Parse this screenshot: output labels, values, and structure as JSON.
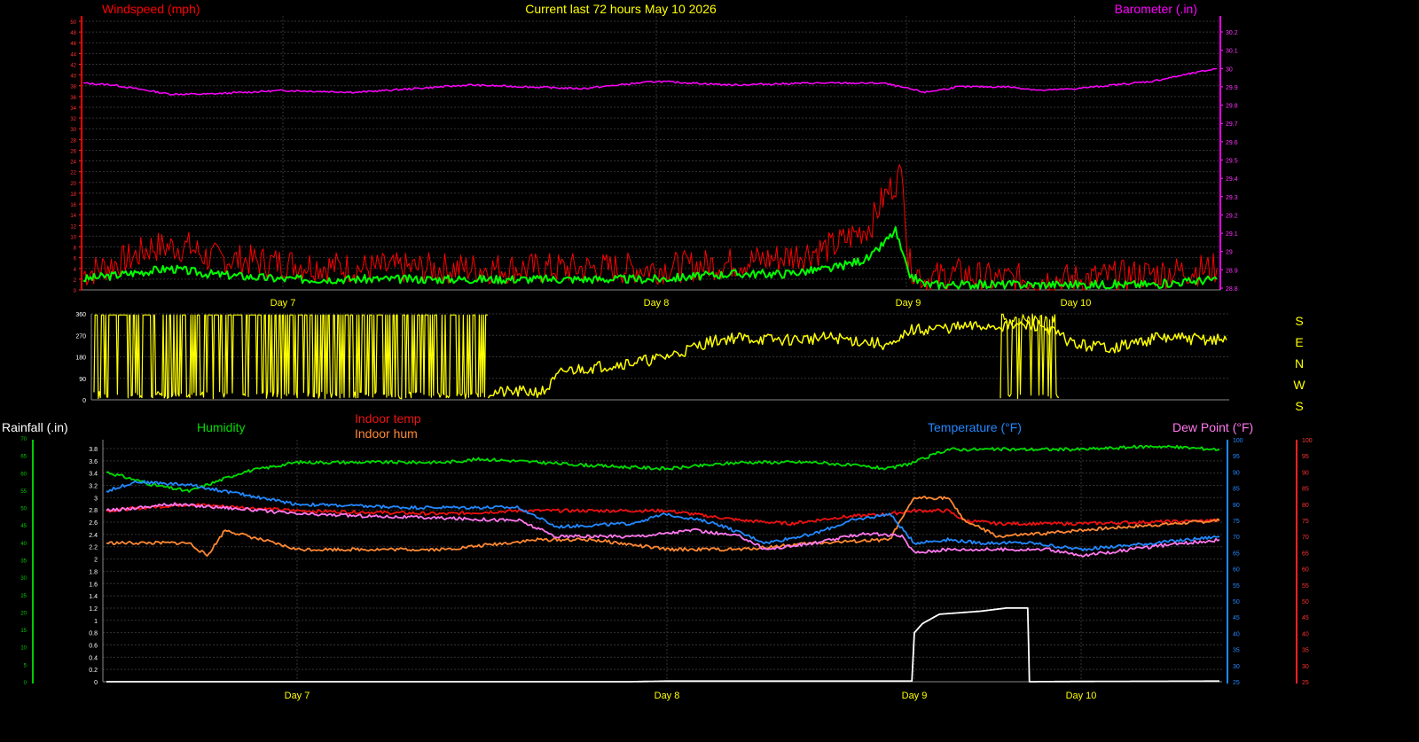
{
  "title": "Current last 72 hours May 10 2026",
  "colors": {
    "bg": "#000000",
    "grid": "#333333",
    "axis": "#888888",
    "tick": "#ffff00",
    "wind_gust": "#ff0000",
    "wind_avg": "#00ff00",
    "barometer": "#ff00ff",
    "direction": "#ffff00",
    "humidity": "#00dd00",
    "indoor_temp": "#ee1111",
    "indoor_hum": "#ff8833",
    "temperature": "#2288ff",
    "dewpoint": "#ff77ee",
    "rainfall": "#ffffff",
    "rain_axis": "#00cc00"
  },
  "day_labels": [
    "Day 7",
    "Day 8",
    "Day 9",
    "Day 10"
  ],
  "compass": [
    "S",
    "E",
    "N",
    "W",
    "S"
  ],
  "chart_data": [
    {
      "id": "wind-baro",
      "type": "line",
      "left_axis_label": "Windspeed (mph)",
      "right_axis_label": "Barometer (.in)",
      "x": [
        "May 7 00:00",
        "May 8 00:00",
        "May 9 00:00",
        "May 10 00:00"
      ],
      "ylim_left": [
        0,
        50
      ],
      "left_ticks": [
        "0",
        "2",
        "4",
        "6",
        "8",
        "10",
        "12",
        "14",
        "16",
        "18",
        "20",
        "22",
        "24",
        "26",
        "28",
        "30",
        "32",
        "34",
        "36",
        "38",
        "40",
        "42",
        "44",
        "46",
        "48",
        "50"
      ],
      "ylim_right": [
        28.8,
        30.2
      ],
      "right_ticks": [
        "28.8",
        "28.9",
        "29",
        "29.1",
        "29.2",
        "29.3",
        "29.4",
        "29.5",
        "29.6",
        "29.7",
        "29.8",
        "29.9",
        "30",
        "30.1",
        "30.2"
      ],
      "series": [
        {
          "name": "gust",
          "color_key": "wind_gust",
          "points": [
            [
              -0.53,
              3
            ],
            [
              -0.4,
              6
            ],
            [
              -0.35,
              8
            ],
            [
              -0.25,
              8
            ],
            [
              -0.2,
              6
            ],
            [
              0.0,
              5
            ],
            [
              0.2,
              4
            ],
            [
              0.5,
              4
            ],
            [
              0.8,
              4
            ],
            [
              1.0,
              4
            ],
            [
              1.3,
              5
            ],
            [
              1.5,
              6
            ],
            [
              1.7,
              8
            ],
            [
              1.85,
              12
            ],
            [
              1.9,
              17
            ],
            [
              1.98,
              22
            ],
            [
              2.0,
              5
            ],
            [
              2.1,
              2
            ],
            [
              2.3,
              3
            ],
            [
              2.5,
              2
            ],
            [
              2.8,
              2
            ],
            [
              3.0,
              2
            ],
            [
              3.2,
              3
            ],
            [
              3.37,
              4
            ]
          ]
        },
        {
          "name": "average",
          "color_key": "wind_avg",
          "points": [
            [
              -0.53,
              2
            ],
            [
              -0.3,
              4
            ],
            [
              -0.2,
              3
            ],
            [
              0.0,
              2
            ],
            [
              0.3,
              2
            ],
            [
              0.5,
              2
            ],
            [
              0.8,
              2
            ],
            [
              1.0,
              2
            ],
            [
              1.3,
              3
            ],
            [
              1.5,
              3
            ],
            [
              1.7,
              4
            ],
            [
              1.85,
              6
            ],
            [
              1.95,
              11
            ],
            [
              2.0,
              3
            ],
            [
              2.1,
              1
            ],
            [
              2.3,
              1
            ],
            [
              2.5,
              1
            ],
            [
              2.8,
              1
            ],
            [
              3.0,
              1
            ],
            [
              3.2,
              1
            ],
            [
              3.37,
              2
            ]
          ]
        },
        {
          "name": "barometer",
          "color_key": "barometer",
          "axis": "right",
          "points": [
            [
              -0.53,
              29.92
            ],
            [
              -0.45,
              29.91
            ],
            [
              -0.3,
              29.86
            ],
            [
              -0.2,
              29.86
            ],
            [
              0.0,
              29.88
            ],
            [
              0.2,
              29.87
            ],
            [
              0.5,
              29.91
            ],
            [
              0.8,
              29.89
            ],
            [
              1.0,
              29.93
            ],
            [
              1.3,
              29.91
            ],
            [
              1.6,
              29.92
            ],
            [
              1.9,
              29.92
            ],
            [
              2.0,
              29.89
            ],
            [
              2.1,
              29.87
            ],
            [
              2.3,
              29.9
            ],
            [
              2.6,
              29.9
            ],
            [
              2.8,
              29.88
            ],
            [
              3.0,
              29.89
            ],
            [
              3.2,
              29.93
            ],
            [
              3.37,
              30.0
            ]
          ]
        }
      ]
    },
    {
      "id": "wind-direction",
      "type": "line",
      "ylim": [
        0,
        360
      ],
      "ticks": [
        "0",
        "90",
        "180",
        "270",
        "360"
      ],
      "series": [
        {
          "name": "direction",
          "color_key": "direction",
          "points": [
            [
              -0.53,
              330
            ],
            [
              -0.3,
              340
            ],
            [
              0.0,
              350
            ],
            [
              0.3,
              340
            ],
            [
              0.55,
              30
            ],
            [
              0.7,
              35
            ],
            [
              0.75,
              120
            ],
            [
              0.9,
              150
            ],
            [
              1.0,
              170
            ],
            [
              1.1,
              200
            ],
            [
              1.2,
              240
            ],
            [
              1.3,
              260
            ],
            [
              1.5,
              250
            ],
            [
              1.7,
              260
            ],
            [
              1.85,
              240
            ],
            [
              1.95,
              225
            ],
            [
              2.0,
              290
            ],
            [
              2.2,
              300
            ],
            [
              2.5,
              310
            ],
            [
              2.8,
              310
            ],
            [
              3.0,
              230
            ],
            [
              3.1,
              220
            ],
            [
              3.2,
              260
            ],
            [
              3.37,
              250
            ]
          ]
        }
      ]
    },
    {
      "id": "temp-hum-rain",
      "type": "line",
      "left_axis_label": "Rainfall (.in)",
      "labels": [
        "Humidity",
        "Indoor temp",
        "Indoor hum",
        "Temperature (°F)",
        "Dew Point (°F)"
      ],
      "ylim_rain": [
        0,
        3.8
      ],
      "rain_ticks": [
        "0",
        "0.2",
        "0.4",
        "0.6",
        "0.8",
        "1",
        "1.2",
        "1.4",
        "1.6",
        "1.8",
        "2",
        "2.2",
        "2.4",
        "2.6",
        "2.8",
        "3",
        "3.2",
        "3.4",
        "3.6",
        "3.8"
      ],
      "hum_ticks": [
        "0",
        "5",
        "10",
        "15",
        "20",
        "25",
        "30",
        "35",
        "40",
        "45",
        "50",
        "55",
        "60",
        "65",
        "70"
      ],
      "ylim_temp": [
        25,
        100
      ],
      "temp_ticks": [
        "25",
        "30",
        "35",
        "40",
        "45",
        "50",
        "55",
        "60",
        "65",
        "70",
        "75",
        "80",
        "85",
        "90",
        "95",
        "100"
      ],
      "series": [
        {
          "name": "Humidity",
          "color_key": "humidity",
          "scale": "temp",
          "points": [
            [
              -0.53,
              90
            ],
            [
              -0.4,
              86
            ],
            [
              -0.3,
              84
            ],
            [
              -0.15,
              90
            ],
            [
              0.0,
              93
            ],
            [
              0.4,
              93
            ],
            [
              0.5,
              94
            ],
            [
              0.8,
              92
            ],
            [
              1.0,
              91
            ],
            [
              1.3,
              93
            ],
            [
              1.6,
              93
            ],
            [
              1.9,
              91
            ],
            [
              2.0,
              93
            ],
            [
              2.2,
              97
            ],
            [
              2.5,
              97
            ],
            [
              2.8,
              97
            ],
            [
              3.0,
              97
            ],
            [
              3.2,
              98
            ],
            [
              3.37,
              97
            ]
          ]
        },
        {
          "name": "Indoor temp",
          "color_key": "indoor_temp",
          "scale": "temp",
          "points": [
            [
              -0.53,
              78
            ],
            [
              -0.3,
              80
            ],
            [
              0.0,
              78
            ],
            [
              0.4,
              77
            ],
            [
              0.6,
              78
            ],
            [
              1.0,
              78
            ],
            [
              1.3,
              75
            ],
            [
              1.5,
              74
            ],
            [
              1.7,
              76
            ],
            [
              1.9,
              77
            ],
            [
              2.0,
              78
            ],
            [
              2.2,
              78
            ],
            [
              2.3,
              75
            ],
            [
              2.5,
              74
            ],
            [
              2.8,
              74
            ],
            [
              3.0,
              74
            ],
            [
              3.37,
              75
            ]
          ]
        },
        {
          "name": "Indoor hum",
          "color_key": "indoor_hum",
          "scale": "temp",
          "points": [
            [
              -0.53,
              68
            ],
            [
              -0.3,
              68
            ],
            [
              -0.25,
              64
            ],
            [
              -0.2,
              72
            ],
            [
              0.0,
              66
            ],
            [
              0.4,
              66
            ],
            [
              0.65,
              69
            ],
            [
              0.8,
              69
            ],
            [
              1.0,
              66
            ],
            [
              1.3,
              66
            ],
            [
              1.6,
              68
            ],
            [
              1.9,
              69
            ],
            [
              2.0,
              82
            ],
            [
              2.2,
              82
            ],
            [
              2.3,
              75
            ],
            [
              2.5,
              70
            ],
            [
              2.8,
              71
            ],
            [
              3.0,
              72
            ],
            [
              3.37,
              75
            ]
          ]
        },
        {
          "name": "Temperature (°F)",
          "color_key": "temperature",
          "scale": "temp",
          "points": [
            [
              -0.53,
              84
            ],
            [
              -0.45,
              87
            ],
            [
              -0.3,
              86
            ],
            [
              -0.2,
              84
            ],
            [
              0.0,
              80
            ],
            [
              0.3,
              79
            ],
            [
              0.6,
              79
            ],
            [
              0.7,
              73
            ],
            [
              0.9,
              74
            ],
            [
              1.0,
              77
            ],
            [
              1.2,
              74
            ],
            [
              1.4,
              68
            ],
            [
              1.6,
              71
            ],
            [
              1.75,
              75
            ],
            [
              1.9,
              77
            ],
            [
              2.0,
              68
            ],
            [
              2.2,
              69
            ],
            [
              2.4,
              68
            ],
            [
              2.7,
              68
            ],
            [
              3.0,
              66
            ],
            [
              3.2,
              68
            ],
            [
              3.37,
              70
            ]
          ]
        },
        {
          "name": "Dew Point (°F)",
          "color_key": "dewpoint",
          "scale": "temp",
          "points": [
            [
              -0.53,
              78
            ],
            [
              -0.35,
              80
            ],
            [
              -0.2,
              79
            ],
            [
              0.0,
              77
            ],
            [
              0.3,
              76
            ],
            [
              0.6,
              75
            ],
            [
              0.7,
              70
            ],
            [
              0.9,
              70
            ],
            [
              1.1,
              72
            ],
            [
              1.3,
              70
            ],
            [
              1.4,
              66
            ],
            [
              1.6,
              68
            ],
            [
              1.8,
              71
            ],
            [
              1.95,
              70
            ],
            [
              2.0,
              65
            ],
            [
              2.2,
              66
            ],
            [
              2.5,
              66
            ],
            [
              2.8,
              66
            ],
            [
              3.0,
              64
            ],
            [
              3.2,
              67
            ],
            [
              3.37,
              69
            ]
          ]
        },
        {
          "name": "Rainfall",
          "color_key": "rainfall",
          "scale": "rain",
          "points": [
            [
              -0.53,
              0
            ],
            [
              0.9,
              0
            ],
            [
              1.0,
              0.01
            ],
            [
              1.99,
              0.01
            ],
            [
              2.0,
              0.8
            ],
            [
              2.05,
              0.95
            ],
            [
              2.15,
              1.1
            ],
            [
              2.4,
              1.15
            ],
            [
              2.55,
              1.2
            ],
            [
              2.68,
              1.2
            ],
            [
              2.69,
              0
            ],
            [
              3.37,
              0.01
            ]
          ]
        }
      ]
    }
  ]
}
